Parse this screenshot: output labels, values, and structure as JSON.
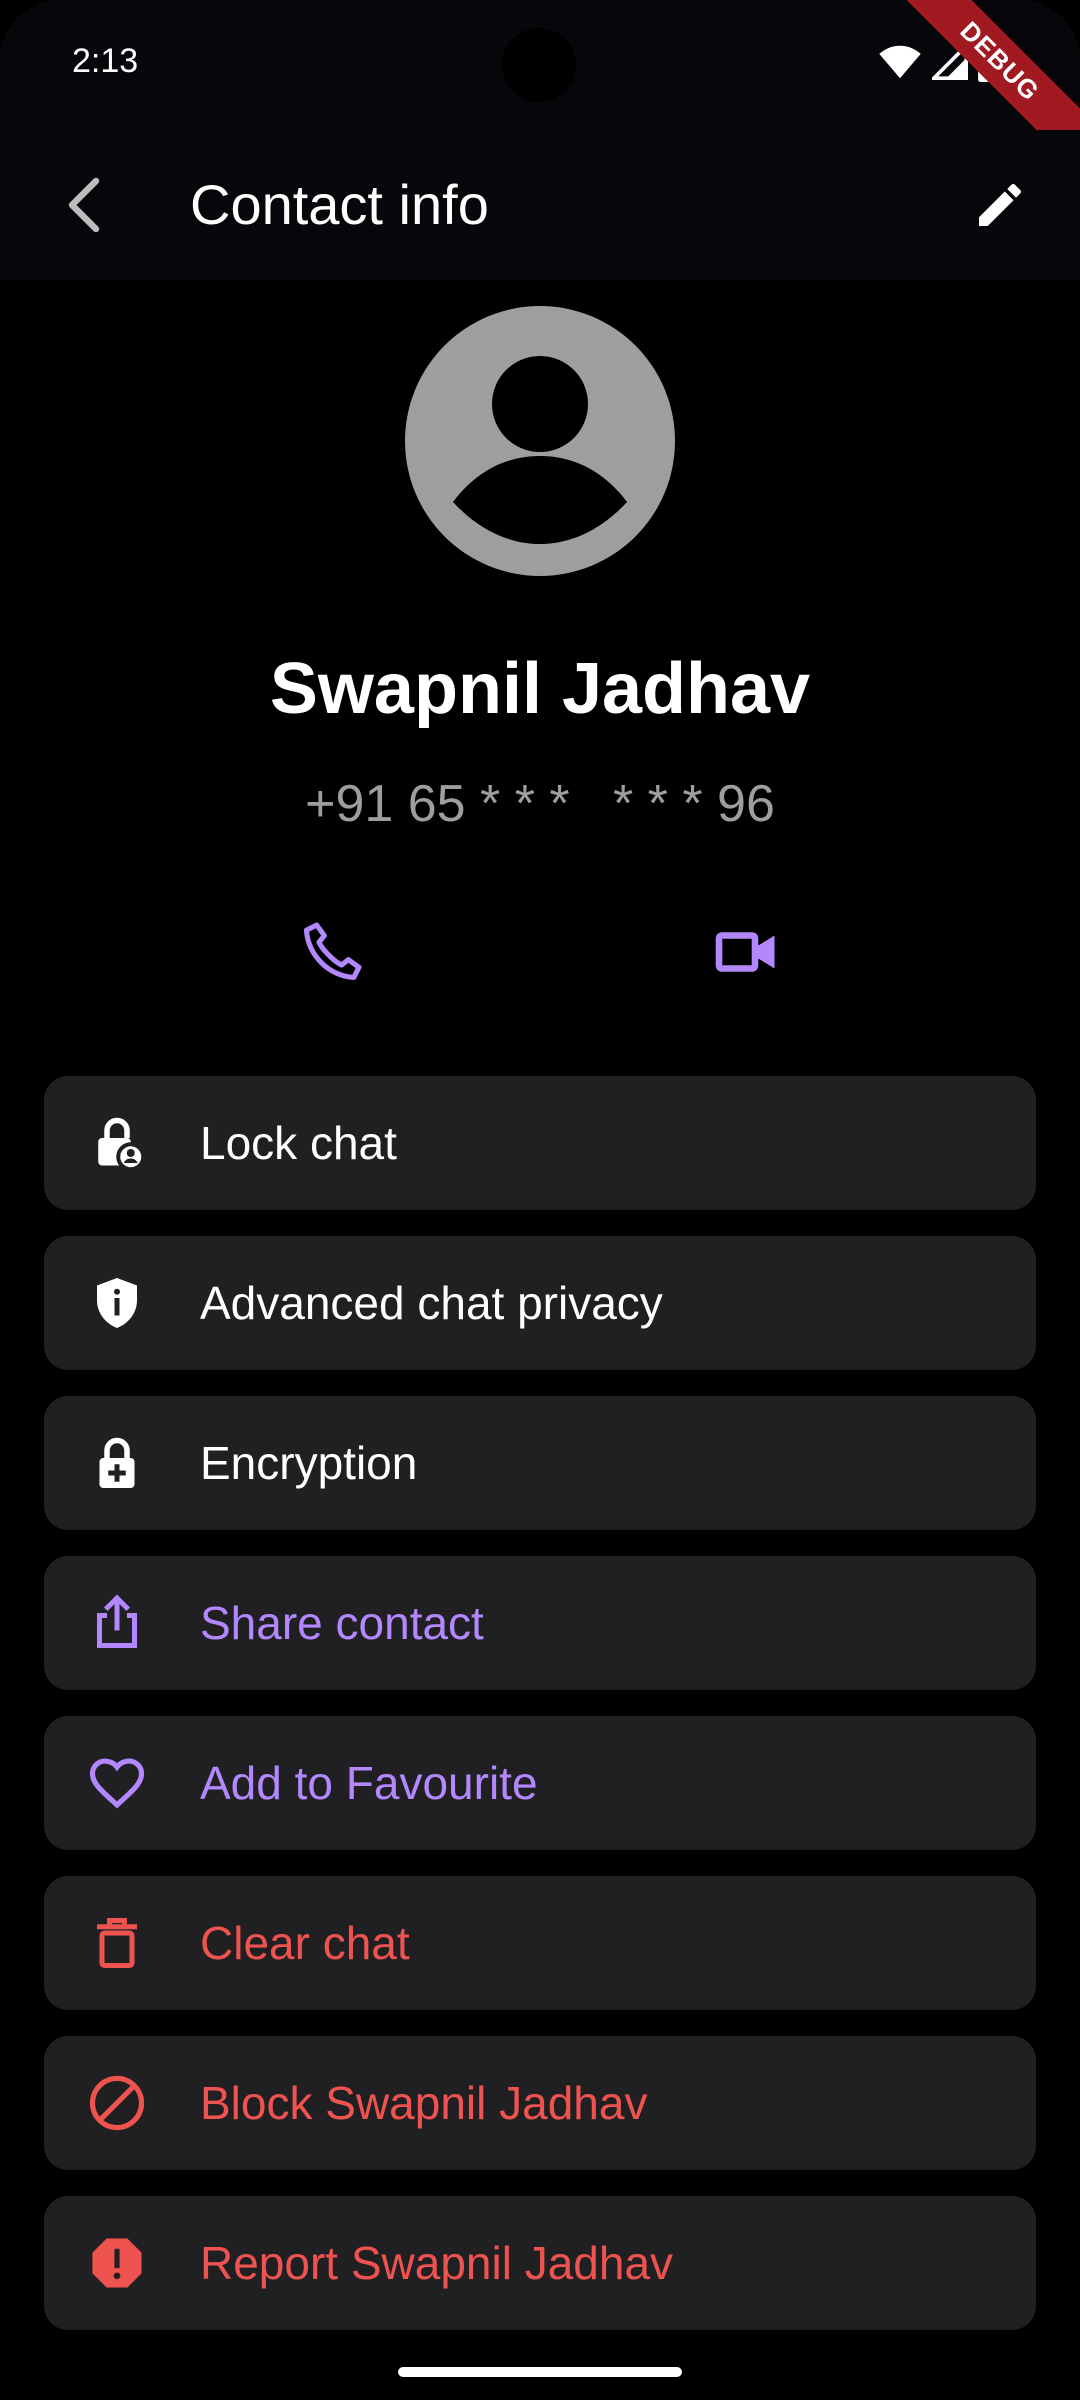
{
  "colors": {
    "accent": "#b388ff",
    "danger": "#ef5350",
    "text": "#ffffff",
    "muted": "#9e9e9e",
    "card": "#202022",
    "avatar": "#9e9e9e"
  },
  "status_bar": {
    "time": "2:13",
    "debug_label": "DEBUG",
    "icons": [
      "wifi-icon",
      "signal-icon",
      "battery-icon"
    ]
  },
  "app_bar": {
    "title": "Contact info",
    "back_icon": "chevron-left-icon",
    "edit_icon": "pencil-icon"
  },
  "contact": {
    "name": "Swapnil Jadhav",
    "phone": "+91 65 * * *   * * * 96",
    "avatar_icon": "person-icon"
  },
  "actions": {
    "call_icon": "phone-icon",
    "video_icon": "video-camera-icon"
  },
  "options": [
    {
      "label": "Lock chat",
      "icon": "lock-person-icon",
      "tone": "normal"
    },
    {
      "label": "Advanced chat privacy",
      "icon": "shield-info-icon",
      "tone": "normal"
    },
    {
      "label": "Encryption",
      "icon": "lock-plus-icon",
      "tone": "normal"
    },
    {
      "label": "Share contact",
      "icon": "share-icon",
      "tone": "accent"
    },
    {
      "label": "Add to Favourite",
      "icon": "heart-icon",
      "tone": "accent"
    },
    {
      "label": "Clear chat",
      "icon": "trash-icon",
      "tone": "danger"
    },
    {
      "label": "Block Swapnil Jadhav",
      "icon": "block-icon",
      "tone": "danger"
    },
    {
      "label": "Report Swapnil Jadhav",
      "icon": "report-icon",
      "tone": "danger"
    }
  ]
}
